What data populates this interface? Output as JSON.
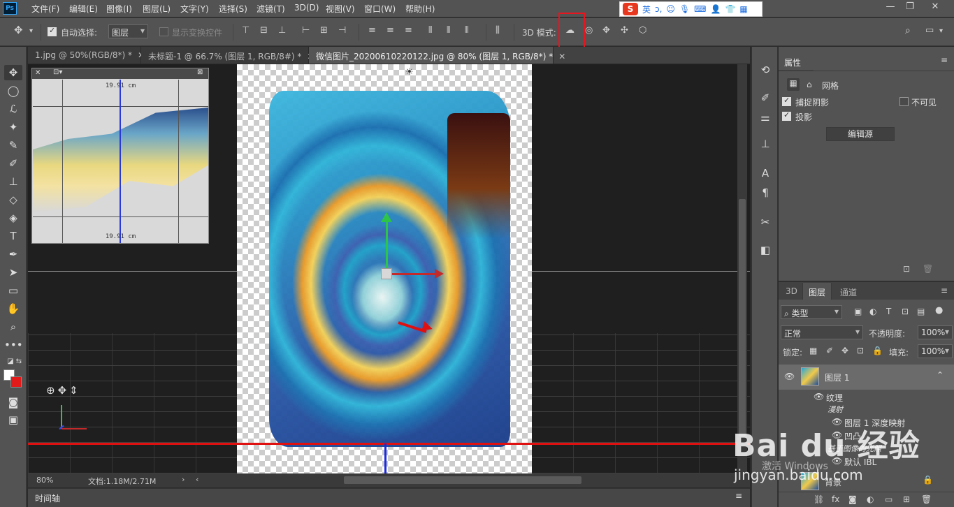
{
  "app": {
    "logo": "Ps"
  },
  "menu": [
    "文件(F)",
    "编辑(E)",
    "图像(I)",
    "图层(L)",
    "文字(Y)",
    "选择(S)",
    "滤镜(T)",
    "3D(D)",
    "视图(V)",
    "窗口(W)",
    "帮助(H)"
  ],
  "ime": {
    "logo": "S",
    "lang": "英",
    "punct": "ɔ,",
    "icons": [
      "smile-icon",
      "mic-icon",
      "keyboard-icon",
      "user-icon",
      "shirt-icon",
      "grid-icon"
    ]
  },
  "window_controls": {
    "minimize": "—",
    "restore": "❐",
    "close": "✕"
  },
  "options": {
    "auto_select_label": "自动选择:",
    "auto_select_value": "图层",
    "show_transform_label": "显示变换控件",
    "mode3d_label": "3D 模式:"
  },
  "tabs": [
    {
      "label": "1.jpg @ 50%(RGB/8*) *",
      "active": false
    },
    {
      "label": "未标题-1 @ 66.7% (图层 1, RGB/8#) *",
      "active": false
    },
    {
      "label": "微信图片_20200610220122.jpg @ 80% (图层 1, RGB/8*) *",
      "active": true
    }
  ],
  "secondary_view": {
    "dim_top": "19.91 cm",
    "dim_bottom": "19.91 cm"
  },
  "status": {
    "zoom": "80%",
    "doc": "文档:1.18M/2.71M"
  },
  "timeline": {
    "label": "时间轴"
  },
  "properties": {
    "title": "属性",
    "sub_label": "网格",
    "capture_shadows": "捕捉阴影",
    "invisible": "不可见",
    "cast_shadows": "投影",
    "edit_source": "编辑源"
  },
  "layers_panel": {
    "tabs": [
      "3D",
      "图层",
      "通道"
    ],
    "active_tab": "图层",
    "filter_kind": "类型",
    "blend_mode": "正常",
    "opacity_label": "不透明度:",
    "opacity_value": "100%",
    "lock_label": "锁定:",
    "fill_label": "填充:",
    "fill_value": "100%",
    "layers": [
      {
        "name": "图层 1",
        "selected": true
      },
      {
        "name": "纹理",
        "selected": false
      },
      {
        "name": "漫射",
        "selected": false
      },
      {
        "name": "图层 1 深度映射",
        "selected": false
      },
      {
        "name": "凹凸",
        "selected": false
      },
      {
        "name": "基于图像的光照",
        "selected": false
      },
      {
        "name": "默认 IBL",
        "selected": false
      },
      {
        "name": "背景",
        "selected": false
      }
    ]
  },
  "watermark": {
    "brand": "Bai du 经验",
    "sub": "激活 Windows",
    "url": "jingyan.baidu.com"
  },
  "colors": {
    "panel_bg": "#535353",
    "canvas_bg": "#1f1f1f",
    "highlight": "#e8141e",
    "foreground_color": "#ffffff",
    "background_color": "#e21a1a"
  }
}
